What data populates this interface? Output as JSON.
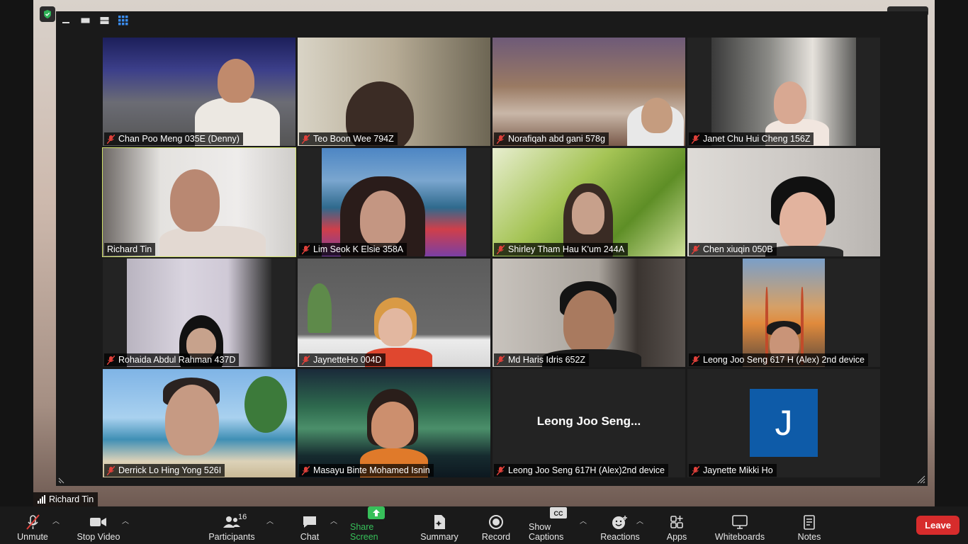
{
  "meeting": {
    "active_speaker_name": "Richard Tin"
  },
  "participants": [
    {
      "name": "Chan Poo Meng 035E (Denny)",
      "muted": true
    },
    {
      "name": "Teo Boon Wee 794Z",
      "muted": true
    },
    {
      "name": "Norafiqah abd gani 578g",
      "muted": true
    },
    {
      "name": "Janet Chu Hui Cheng 156Z",
      "muted": true
    },
    {
      "name": "Richard Tin",
      "muted": false
    },
    {
      "name": "Lim Seok K Elsie 358A",
      "muted": true
    },
    {
      "name": "Shirley Tham Hau K'um 244A",
      "muted": true
    },
    {
      "name": "Chen xiuqin 050B",
      "muted": true
    },
    {
      "name": "Rohaida Abdul Rahman 437D",
      "muted": true
    },
    {
      "name": "JaynetteHo 004D",
      "muted": true
    },
    {
      "name": "Md Haris Idris 652Z",
      "muted": true
    },
    {
      "name": "Leong Joo Seng 617 H (Alex) 2nd device",
      "muted": true
    },
    {
      "name": "Derrick Lo Hing Yong 526I",
      "muted": true
    },
    {
      "name": "Masayu Binte Mohamed Isnin",
      "muted": true
    },
    {
      "name": "Leong Joo Seng 617H (Alex)2nd device",
      "muted": true,
      "center_label": "Leong Joo Seng..."
    },
    {
      "name": "Jaynette Mikki Ho",
      "muted": true,
      "avatar_letter": "J"
    }
  ],
  "toolbar": {
    "unmute": "Unmute",
    "stop_video": "Stop Video",
    "participants": "Participants",
    "participants_count": "16",
    "chat": "Chat",
    "share_screen": "Share Screen",
    "summary": "Summary",
    "record": "Record",
    "show_captions": "Show Captions",
    "reactions": "Reactions",
    "apps": "Apps",
    "whiteboards": "Whiteboards",
    "notes": "Notes",
    "leave": "Leave"
  },
  "colors": {
    "leave": "#d72c2c",
    "share": "#37c05a",
    "active_outline": "#cfe06a",
    "avatar": "#0e5ba8",
    "muted_icon": "#e0403a"
  }
}
